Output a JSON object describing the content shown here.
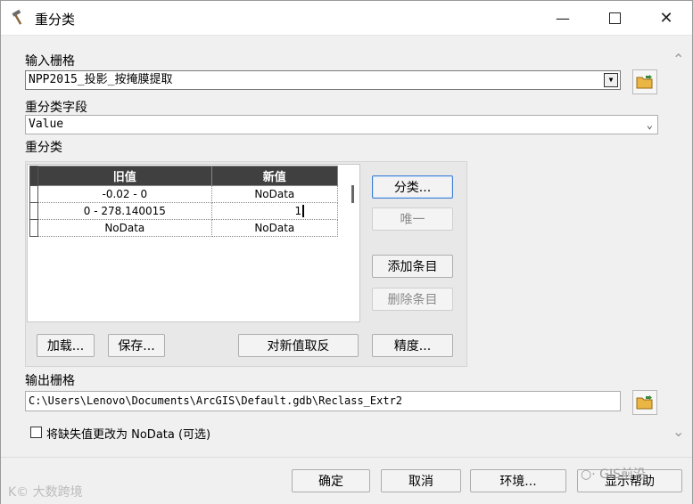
{
  "window": {
    "title": "重分类",
    "icon": "hammer-icon"
  },
  "input_raster": {
    "label": "输入栅格",
    "value": "NPP2015_投影_按掩膜提取"
  },
  "reclass_field": {
    "label": "重分类字段",
    "value": "Value"
  },
  "reclassification": {
    "label": "重分类",
    "columns": [
      "旧值",
      "新值"
    ],
    "rows": [
      {
        "old": "-0.02 - 0",
        "new": "NoData"
      },
      {
        "old": "0 - 278.140015",
        "new": "1"
      },
      {
        "old": "NoData",
        "new": "NoData"
      }
    ],
    "buttons": {
      "classify": "分类...",
      "unique": "唯一",
      "add_entry": "添加条目",
      "delete_entry": "删除条目",
      "load": "加载...",
      "save": "保存...",
      "reverse": "对新值取反",
      "precision": "精度..."
    }
  },
  "output_raster": {
    "label": "输出栅格",
    "value": "C:\\Users\\Lenovo\\Documents\\ArcGIS\\Default.gdb\\Reclass_Extr2"
  },
  "missing_to_nodata": {
    "label": "将缺失值更改为 NoData (可选)",
    "checked": false
  },
  "footer": {
    "ok": "确定",
    "cancel": "取消",
    "environments": "环境...",
    "show_help": "显示帮助"
  },
  "watermarks": {
    "left": "大数跨境",
    "right": "GIS前沿"
  }
}
